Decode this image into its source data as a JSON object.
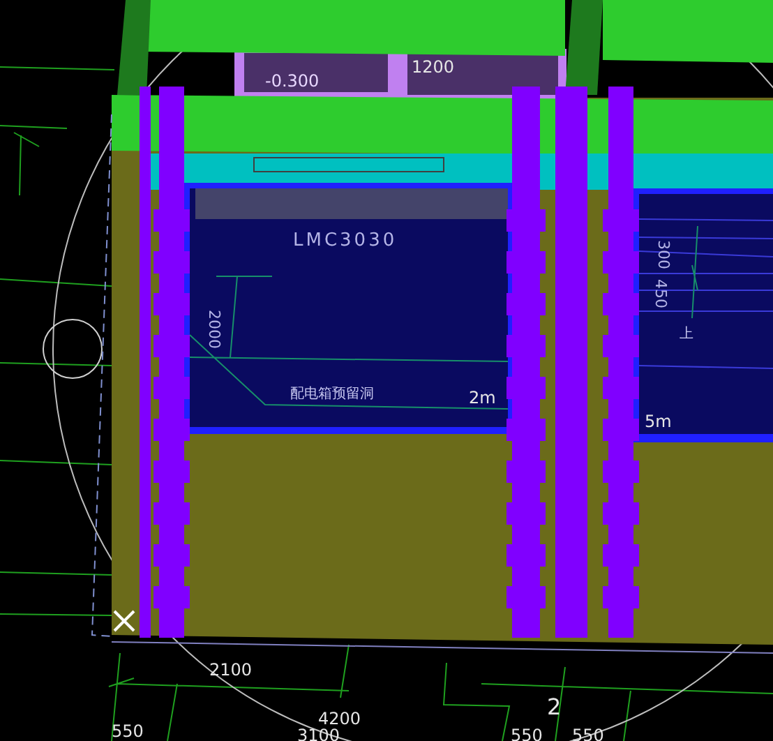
{
  "viewport": {
    "labels": [
      {
        "kind": "elevation",
        "text": "-0.300"
      },
      {
        "kind": "dimension",
        "text": "1200"
      },
      {
        "kind": "tag",
        "text": "LMC3030"
      },
      {
        "kind": "vertical",
        "text": "2000"
      },
      {
        "kind": "note",
        "text": "配电箱预留洞"
      },
      {
        "kind": "dimension",
        "text": "2m"
      },
      {
        "kind": "vertical",
        "text": "300"
      },
      {
        "kind": "vertical",
        "text": "450"
      },
      {
        "kind": "note",
        "text": "上"
      },
      {
        "kind": "dimension",
        "text": "5m"
      },
      {
        "kind": "dimension",
        "text": "2100"
      },
      {
        "kind": "dimension",
        "text": "4200"
      },
      {
        "kind": "dimension",
        "text": "550"
      },
      {
        "kind": "dimension",
        "text": "3100"
      },
      {
        "kind": "axis",
        "text": "2"
      },
      {
        "kind": "dimension",
        "text": "550"
      },
      {
        "kind": "dimension",
        "text": "550"
      }
    ]
  }
}
